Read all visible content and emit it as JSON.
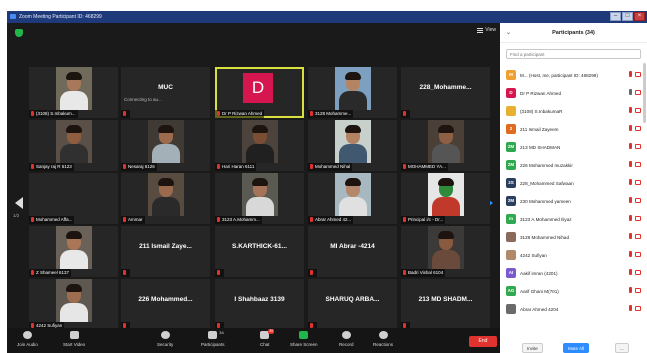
{
  "window": {
    "title": "Zoom Meeting Participant ID: 468299"
  },
  "meeting": {
    "view_label": "View",
    "page_left": "1/2",
    "page_right": "1/2",
    "tiles": [
      {
        "name": "(3108) S.Inbakum...",
        "kind": "photo",
        "skin": "#a9775a",
        "bg": "#6f6a5a",
        "shirt": "#e8e8e8"
      },
      {
        "name": "MUC",
        "kind": "text",
        "sub": "Connecting to au..."
      },
      {
        "name": "Dr P Rizwan Ahmed",
        "kind": "letter",
        "letter": "D",
        "active": true
      },
      {
        "name": "3128 Mohamme...",
        "kind": "photo",
        "skin": "#b58463",
        "bg": "#7da0c0",
        "shirt": "#2a2a2a"
      },
      {
        "name": "228_Mohamme...",
        "kind": "text",
        "sub": ""
      },
      {
        "name": "Sanjay raj R 6123",
        "kind": "photo",
        "skin": "#8f5d40",
        "bg": "#5a5048",
        "shirt": "#303030"
      },
      {
        "name": "Nesaraj 6126",
        "kind": "photo",
        "skin": "#9c6a4c",
        "bg": "#3f3a34",
        "shirt": "#a3b0b8"
      },
      {
        "name": "Hari Haran 6111",
        "kind": "photo",
        "skin": "#7a4e34",
        "bg": "#4c443c",
        "shirt": "#202020"
      },
      {
        "name": "Mohammed Nihal",
        "kind": "photo",
        "skin": "#b38262",
        "bg": "#c8d0cc",
        "shirt": "#405870"
      },
      {
        "name": "MOHAMMED YA...",
        "kind": "photo",
        "skin": "#8d5f44",
        "bg": "#4a4038",
        "shirt": "#555"
      },
      {
        "name": "Mohammed Affa...",
        "kind": "dark"
      },
      {
        "name": "Ammar",
        "kind": "photo",
        "skin": "#9a6a4e",
        "bg": "#584c40",
        "shirt": "#2a2a2a"
      },
      {
        "name": "3123 A.Mohamm...",
        "kind": "photo",
        "skin": "#a57358",
        "bg": "#5a5a52",
        "shirt": "#d8d8d8"
      },
      {
        "name": "Abrar Ahmed 42...",
        "kind": "photo",
        "skin": "#b4876a",
        "bg": "#a8b8c0",
        "shirt": "#e0e0e0"
      },
      {
        "name": "Principal i/c - Dr...",
        "kind": "photo",
        "skin": "#2f8a3c",
        "bg": "#e6e6e6",
        "shirt": "#c0392b"
      },
      {
        "name": "Z Shameel 6137",
        "kind": "photo",
        "skin": "#aa7656",
        "bg": "#6a6258",
        "shirt": "#e8e8e8"
      },
      {
        "name": "211 Ismail Zaye...",
        "kind": "text",
        "sub": ""
      },
      {
        "name": "S.KARTHICK-61...",
        "kind": "text",
        "sub": ""
      },
      {
        "name": "MI Abrar -4214",
        "kind": "text",
        "sub": ""
      },
      {
        "name": "Badri Vishal 6104",
        "kind": "photo",
        "skin": "#8a5a3e",
        "bg": "#3c3a38",
        "shirt": "#6a4a3a"
      },
      {
        "name": "4242 Sufiyan",
        "kind": "photo",
        "skin": "#9e6c4e",
        "bg": "#5e5850",
        "shirt": "#e6e6e6"
      },
      {
        "name": "226 Mohammed...",
        "kind": "text",
        "sub": ""
      },
      {
        "name": "I Shahbaaz 3139",
        "kind": "text",
        "sub": ""
      },
      {
        "name": "SHARUQ ARBA...",
        "kind": "text",
        "sub": ""
      },
      {
        "name": "213 MD SHADM...",
        "kind": "text",
        "sub": ""
      }
    ]
  },
  "toolbar": {
    "join_audio": "Join Audio",
    "start_video": "Start Video",
    "security": "Security",
    "participants": "Participants",
    "participants_count": "34",
    "chat": "Chat",
    "chat_badge": "20",
    "share_screen": "Share Screen",
    "record": "Record",
    "reactions": "Reactions",
    "end": "End"
  },
  "panel": {
    "title": "Participants (34)",
    "search_placeholder": "Find a participant",
    "invite": "Invite",
    "mute_all": "Mute All",
    "more": "...",
    "participants": [
      {
        "name": "M... (Host, me, participant ID: 468299)",
        "initials": "M",
        "color": "#f0a030",
        "mic": "muted",
        "video": "off"
      },
      {
        "name": "Dr P Rizwan Ahmed",
        "initials": "D",
        "color": "#d6174f",
        "mic": "on",
        "video": "off"
      },
      {
        "name": "(3108) S.InbakumaR",
        "initials": "",
        "color": "#e8b030",
        "mic": "muted",
        "video": "off"
      },
      {
        "name": "211 Ismail Zayeem",
        "initials": "2",
        "color": "#e06a20",
        "mic": "muted",
        "video": "off"
      },
      {
        "name": "213 MD SHADMAN",
        "initials": "2M",
        "color": "#2fa84f",
        "mic": "muted",
        "video": "off"
      },
      {
        "name": "226 Mohammed muzakkir",
        "initials": "2M",
        "color": "#2fa84f",
        "mic": "muted",
        "video": "off"
      },
      {
        "name": "228_Mohammed Safwaan",
        "initials": "2S",
        "color": "#2a3f60",
        "mic": "muted",
        "video": "off"
      },
      {
        "name": "230 Mohammed yameen",
        "initials": "2M",
        "color": "#2a3f60",
        "mic": "muted",
        "video": "off"
      },
      {
        "name": "3123 A.Mohammed Iliyaz",
        "initials": "m",
        "color": "#2fa84f",
        "mic": "muted",
        "video": "off"
      },
      {
        "name": "3128 Mohammed Nihad",
        "initials": "",
        "color": "#8a6a5a",
        "mic": "muted",
        "video": "off"
      },
      {
        "name": "4242 Sufiyan",
        "initials": "",
        "color": "#b08a6a",
        "mic": "muted",
        "video": "off"
      },
      {
        "name": "Aakif imran (4201)",
        "initials": "AI",
        "color": "#7a5acd",
        "mic": "muted",
        "video": "off"
      },
      {
        "name": "Aarif Ghani M(701)",
        "initials": "AG",
        "color": "#2fa84f",
        "mic": "muted",
        "video": "off"
      },
      {
        "name": "Abrar Ahmed 4204",
        "initials": "",
        "color": "#6a6a6a",
        "mic": "muted",
        "video": "off"
      }
    ]
  }
}
